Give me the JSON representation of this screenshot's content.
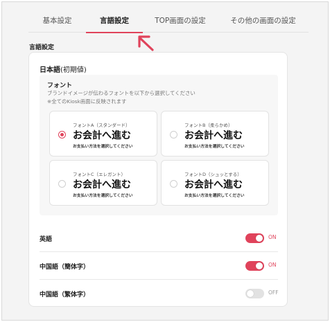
{
  "tabs": [
    {
      "label": "基本設定"
    },
    {
      "label": "言語設定"
    },
    {
      "label": "TOP画面の設定"
    },
    {
      "label": "その他の画面の設定"
    }
  ],
  "active_tab": "言語設定",
  "section_title": "言語設定",
  "japanese": {
    "title": "日本語",
    "title_suffix": "(初期値)",
    "font_label": "フォント",
    "font_desc_1": "ブランドイメージが伝わるフォントを以下から選択してください",
    "font_desc_2": "※全てのKiosk画面に反映されます",
    "options": [
      {
        "name": "フォントA（スタンダード）",
        "sample": "お会計へ進む",
        "sub": "お支払い方法を選択してください",
        "selected": true
      },
      {
        "name": "フォントB（柔らかめ）",
        "sample": "お会計へ進む",
        "sub": "お支払い方法を選択してください",
        "selected": false
      },
      {
        "name": "フォントC（エレガント）",
        "sample": "お会計へ進む",
        "sub": "お支払い方法を選択してください",
        "selected": false
      },
      {
        "name": "フォントD（シュッとする）",
        "sample": "お会計へ進む",
        "sub": "お支払い方法を選択してください",
        "selected": false
      }
    ]
  },
  "languages": [
    {
      "label": "英語",
      "state": "ON",
      "on": true
    },
    {
      "label": "中国語（簡体字）",
      "state": "ON",
      "on": true
    },
    {
      "label": "中国語（繁体字）",
      "state": "OFF",
      "on": false
    }
  ],
  "colors": {
    "accent": "#e0435b",
    "toggle_off": "#e2e2e2",
    "panel_bg": "#f4f4f4"
  },
  "icons": {
    "annotation_arrow": "arrow-pointing-up-left"
  }
}
